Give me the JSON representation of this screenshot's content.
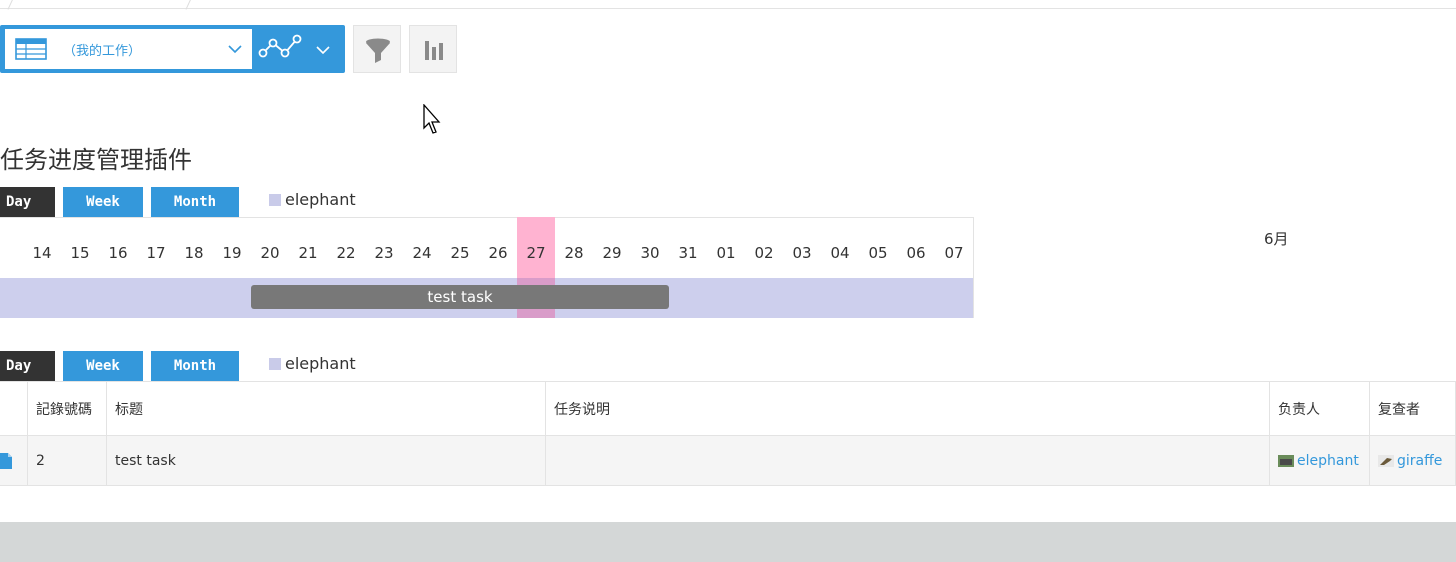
{
  "toolbar": {
    "view_name": "（我的工作）"
  },
  "plugin": {
    "title": "任务进度管理插件"
  },
  "modes": {
    "day": "Day",
    "week": "Week",
    "month": "Month",
    "legend": "elephant"
  },
  "gantt": {
    "month_label": "6月",
    "days": [
      "14",
      "15",
      "16",
      "17",
      "18",
      "19",
      "20",
      "21",
      "22",
      "23",
      "24",
      "25",
      "26",
      "27",
      "28",
      "29",
      "30",
      "31",
      "01",
      "02",
      "03",
      "04",
      "05",
      "06",
      "07"
    ],
    "today": "27",
    "task_label": "test task"
  },
  "table": {
    "headers": {
      "record_no": "記錄號碼",
      "title": "标题",
      "description": "任务说明",
      "assignee": "负责人",
      "reviewer": "复查者"
    },
    "rows": [
      {
        "record_no": "2",
        "title": "test task",
        "description": "",
        "assignee": "elephant",
        "reviewer": "giraffe"
      }
    ]
  },
  "colors": {
    "accent": "#3498db",
    "today": "#ffb3d1",
    "task_row": "#cdcfed",
    "task_bar": "#787878"
  }
}
